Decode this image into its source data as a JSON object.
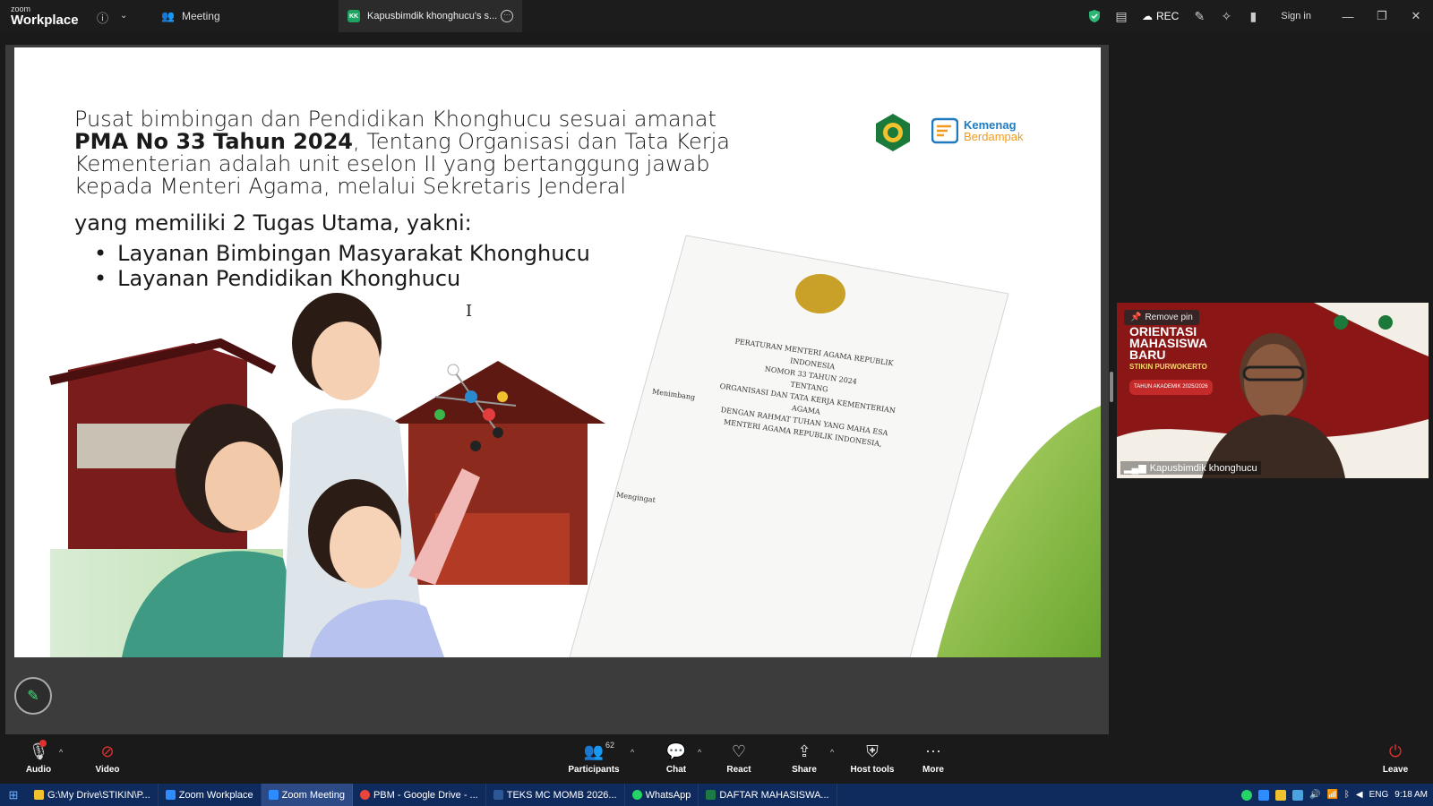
{
  "topbar": {
    "logo_small": "zoom",
    "logo_big": "Workplace",
    "meeting_label": "Meeting",
    "active_tab_badge": "KK",
    "active_tab_label": "Kapusbimdik khonghucu's s...",
    "rec_label": "REC",
    "signin_label": "Sign in",
    "shield_color": "#2bb673"
  },
  "slide": {
    "para_line_1": "Pusat bimbingan dan Pendidikan Khonghucu sesuai amanat",
    "para_bold": "PMA No 33 Tahun 2024",
    "para_line_2_rest": ", Tentang Organisasi dan Tata Kerja",
    "para_line_3": "Kementerian adalah unit eselon II yang bertanggung jawab",
    "para_line_4": "kepada Menteri Agama, melalui Sekretaris Jenderal",
    "tasks_intro": "yang memiliki 2 Tugas Utama, yakni:",
    "bullets": [
      "Layanan Bimbingan Masyarakat Khonghucu",
      "Layanan Pendidikan Khonghucu"
    ],
    "brand_line_1": "Kemenag",
    "brand_line_2": "Berdampak",
    "doc_lines": [
      "PERATURAN MENTERI AGAMA REPUBLIK INDONESIA",
      "NOMOR 33 TAHUN 2024",
      "TENTANG",
      "ORGANISASI DAN TATA KERJA KEMENTERIAN AGAMA",
      "DENGAN RAHMAT TUHAN YANG MAHA ESA",
      "MENTERI AGAMA REPUBLIK INDONESIA,"
    ],
    "doc_menimbang": "Menimbang",
    "doc_mengingat": "Mengingat"
  },
  "participant_tile": {
    "remove_pin_label": "Remove pin",
    "banner_line_1": "ORIENTASI",
    "banner_line_2": "MAHASISWA",
    "banner_line_3": "BARU",
    "banner_line_4": "STIKIN PURWOKERTO",
    "banner_tag": "TAHUN AKADEMIK 2025/2026",
    "name": "Kapusbimdik khonghucu"
  },
  "controls": {
    "audio": "Audio",
    "video": "Video",
    "participants": "Participants",
    "participants_count": "62",
    "chat": "Chat",
    "react": "React",
    "share": "Share",
    "host_tools": "Host tools",
    "more": "More",
    "leave": "Leave"
  },
  "taskbar": {
    "items": [
      {
        "label": "G:\\My Drive\\STIKIN\\P...",
        "color": "#f2c12e"
      },
      {
        "label": "Zoom Workplace",
        "color": "#2d8cff"
      },
      {
        "label": "Zoom Meeting",
        "color": "#2d8cff"
      },
      {
        "label": "PBM - Google Drive - ...",
        "color": "#e8453c"
      },
      {
        "label": "TEKS MC MOMB 2026...",
        "color": "#2b5797"
      },
      {
        "label": "WhatsApp",
        "color": "#25d366"
      },
      {
        "label": "DAFTAR MAHASISWA...",
        "color": "#1d7a45"
      }
    ],
    "lang": "ENG",
    "time": "9:18 AM"
  }
}
